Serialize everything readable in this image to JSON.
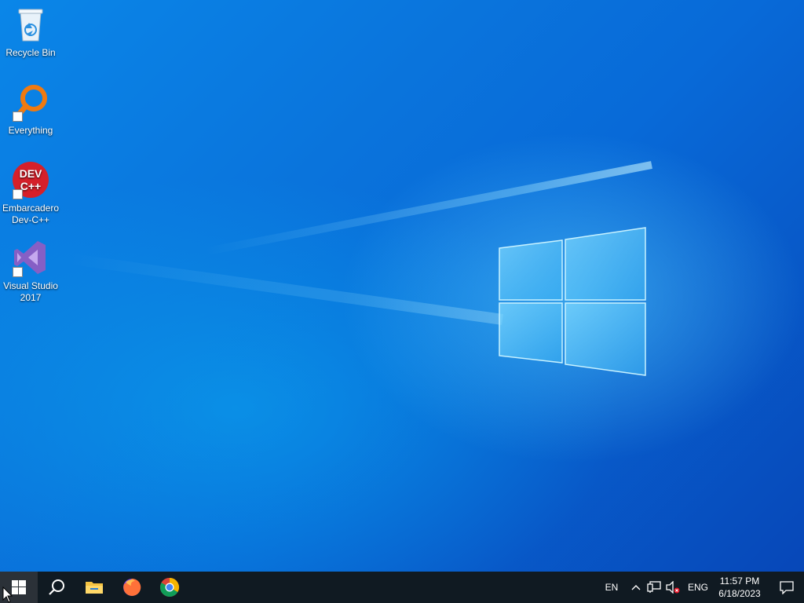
{
  "desktop": {
    "icons": [
      {
        "label": "Recycle Bin",
        "icon": "recycle-bin-icon"
      },
      {
        "label": "Everything",
        "icon": "everything-search-icon"
      },
      {
        "label": "Embarcadero Dev-C++",
        "icon": "dev-cpp-icon",
        "icon_text_top": "DEV",
        "icon_text_bottom": "C++"
      },
      {
        "label": "Visual Studio 2017",
        "icon": "visual-studio-icon"
      }
    ]
  },
  "taskbar": {
    "apps": [
      {
        "name": "Start",
        "icon": "windows-start-icon"
      },
      {
        "name": "Search",
        "icon": "search-icon"
      },
      {
        "name": "File Explorer",
        "icon": "folder-icon"
      },
      {
        "name": "Firefox",
        "icon": "firefox-icon"
      },
      {
        "name": "Chrome",
        "icon": "chrome-icon"
      }
    ],
    "tray": {
      "input_indicator": "EN",
      "language": "ENG",
      "time": "11:57 PM",
      "date": "6/18/2023"
    }
  },
  "colors": {
    "taskbar_bg": "#101a22",
    "desktop_accent": "#0a78e0",
    "mute_badge": "#e81123"
  }
}
